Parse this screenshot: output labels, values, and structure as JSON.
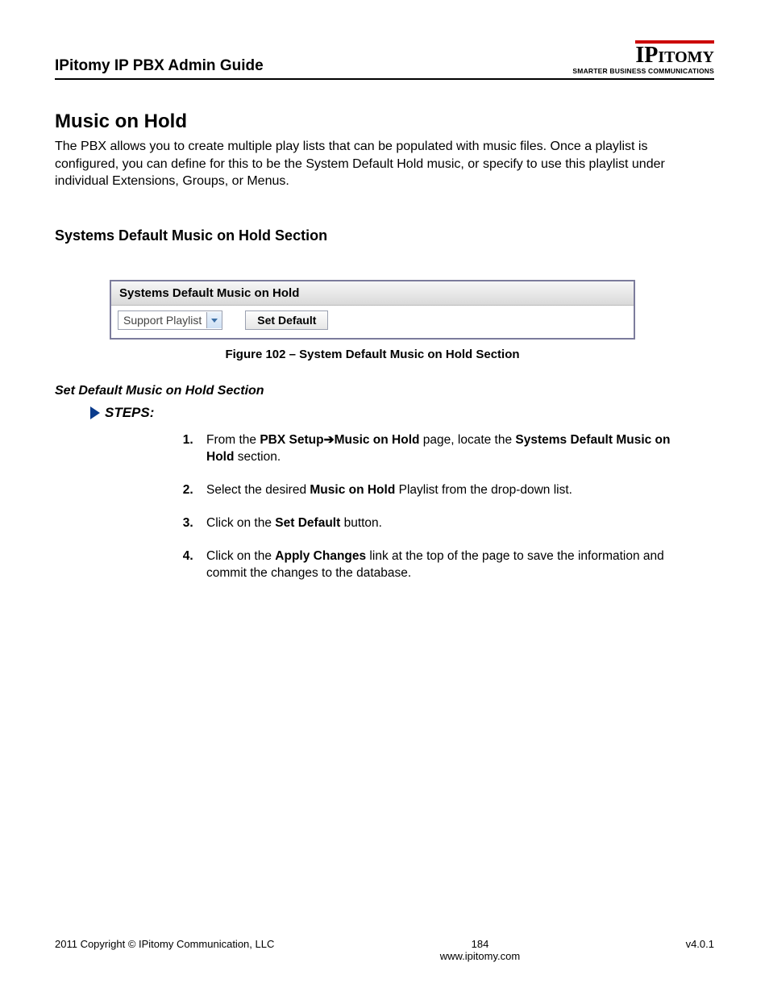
{
  "header": {
    "doc_title": "IPitomy IP PBX Admin Guide",
    "logo_ip": "IP",
    "logo_itomy": "ITOMY",
    "logo_tagline": "SMARTER BUSINESS COMMUNICATIONS"
  },
  "section": {
    "h1": "Music on Hold",
    "intro": "The PBX allows you to create multiple play lists that can be populated with music files.  Once a playlist is configured, you can define for this to be the System Default Hold music, or specify to use this playlist under individual Extensions, Groups, or Menus.",
    "h2": "Systems Default Music on Hold Section"
  },
  "panel": {
    "title": "Systems Default Music on Hold",
    "dropdown_value": "Support Playlist",
    "button_label": "Set Default"
  },
  "figure_caption": "Figure 102 – System Default Music on Hold Section",
  "subsection": {
    "h3": "Set Default Music on Hold Section",
    "steps_label": "STEPS:"
  },
  "steps": [
    {
      "pre": "From the ",
      "b1": "PBX Setup",
      "arrow": "➔",
      "b2": "Music on Hold",
      "mid": " page, locate the ",
      "b3": "Systems Default Music on Hold",
      "post": " section."
    },
    {
      "pre": "Select the desired ",
      "b1": "Music on Hold",
      "post": " Playlist from the drop-down list."
    },
    {
      "pre": "Click on the ",
      "b1": "Set Default",
      "post": " button."
    },
    {
      "pre": "Click on the ",
      "b1": "Apply Changes",
      "post": " link at the top of the page to save the information and commit the changes to the database."
    }
  ],
  "footer": {
    "copyright": "2011 Copyright © IPitomy Communication, LLC",
    "page_number": "184",
    "website": "www.ipitomy.com",
    "version": "v4.0.1"
  }
}
